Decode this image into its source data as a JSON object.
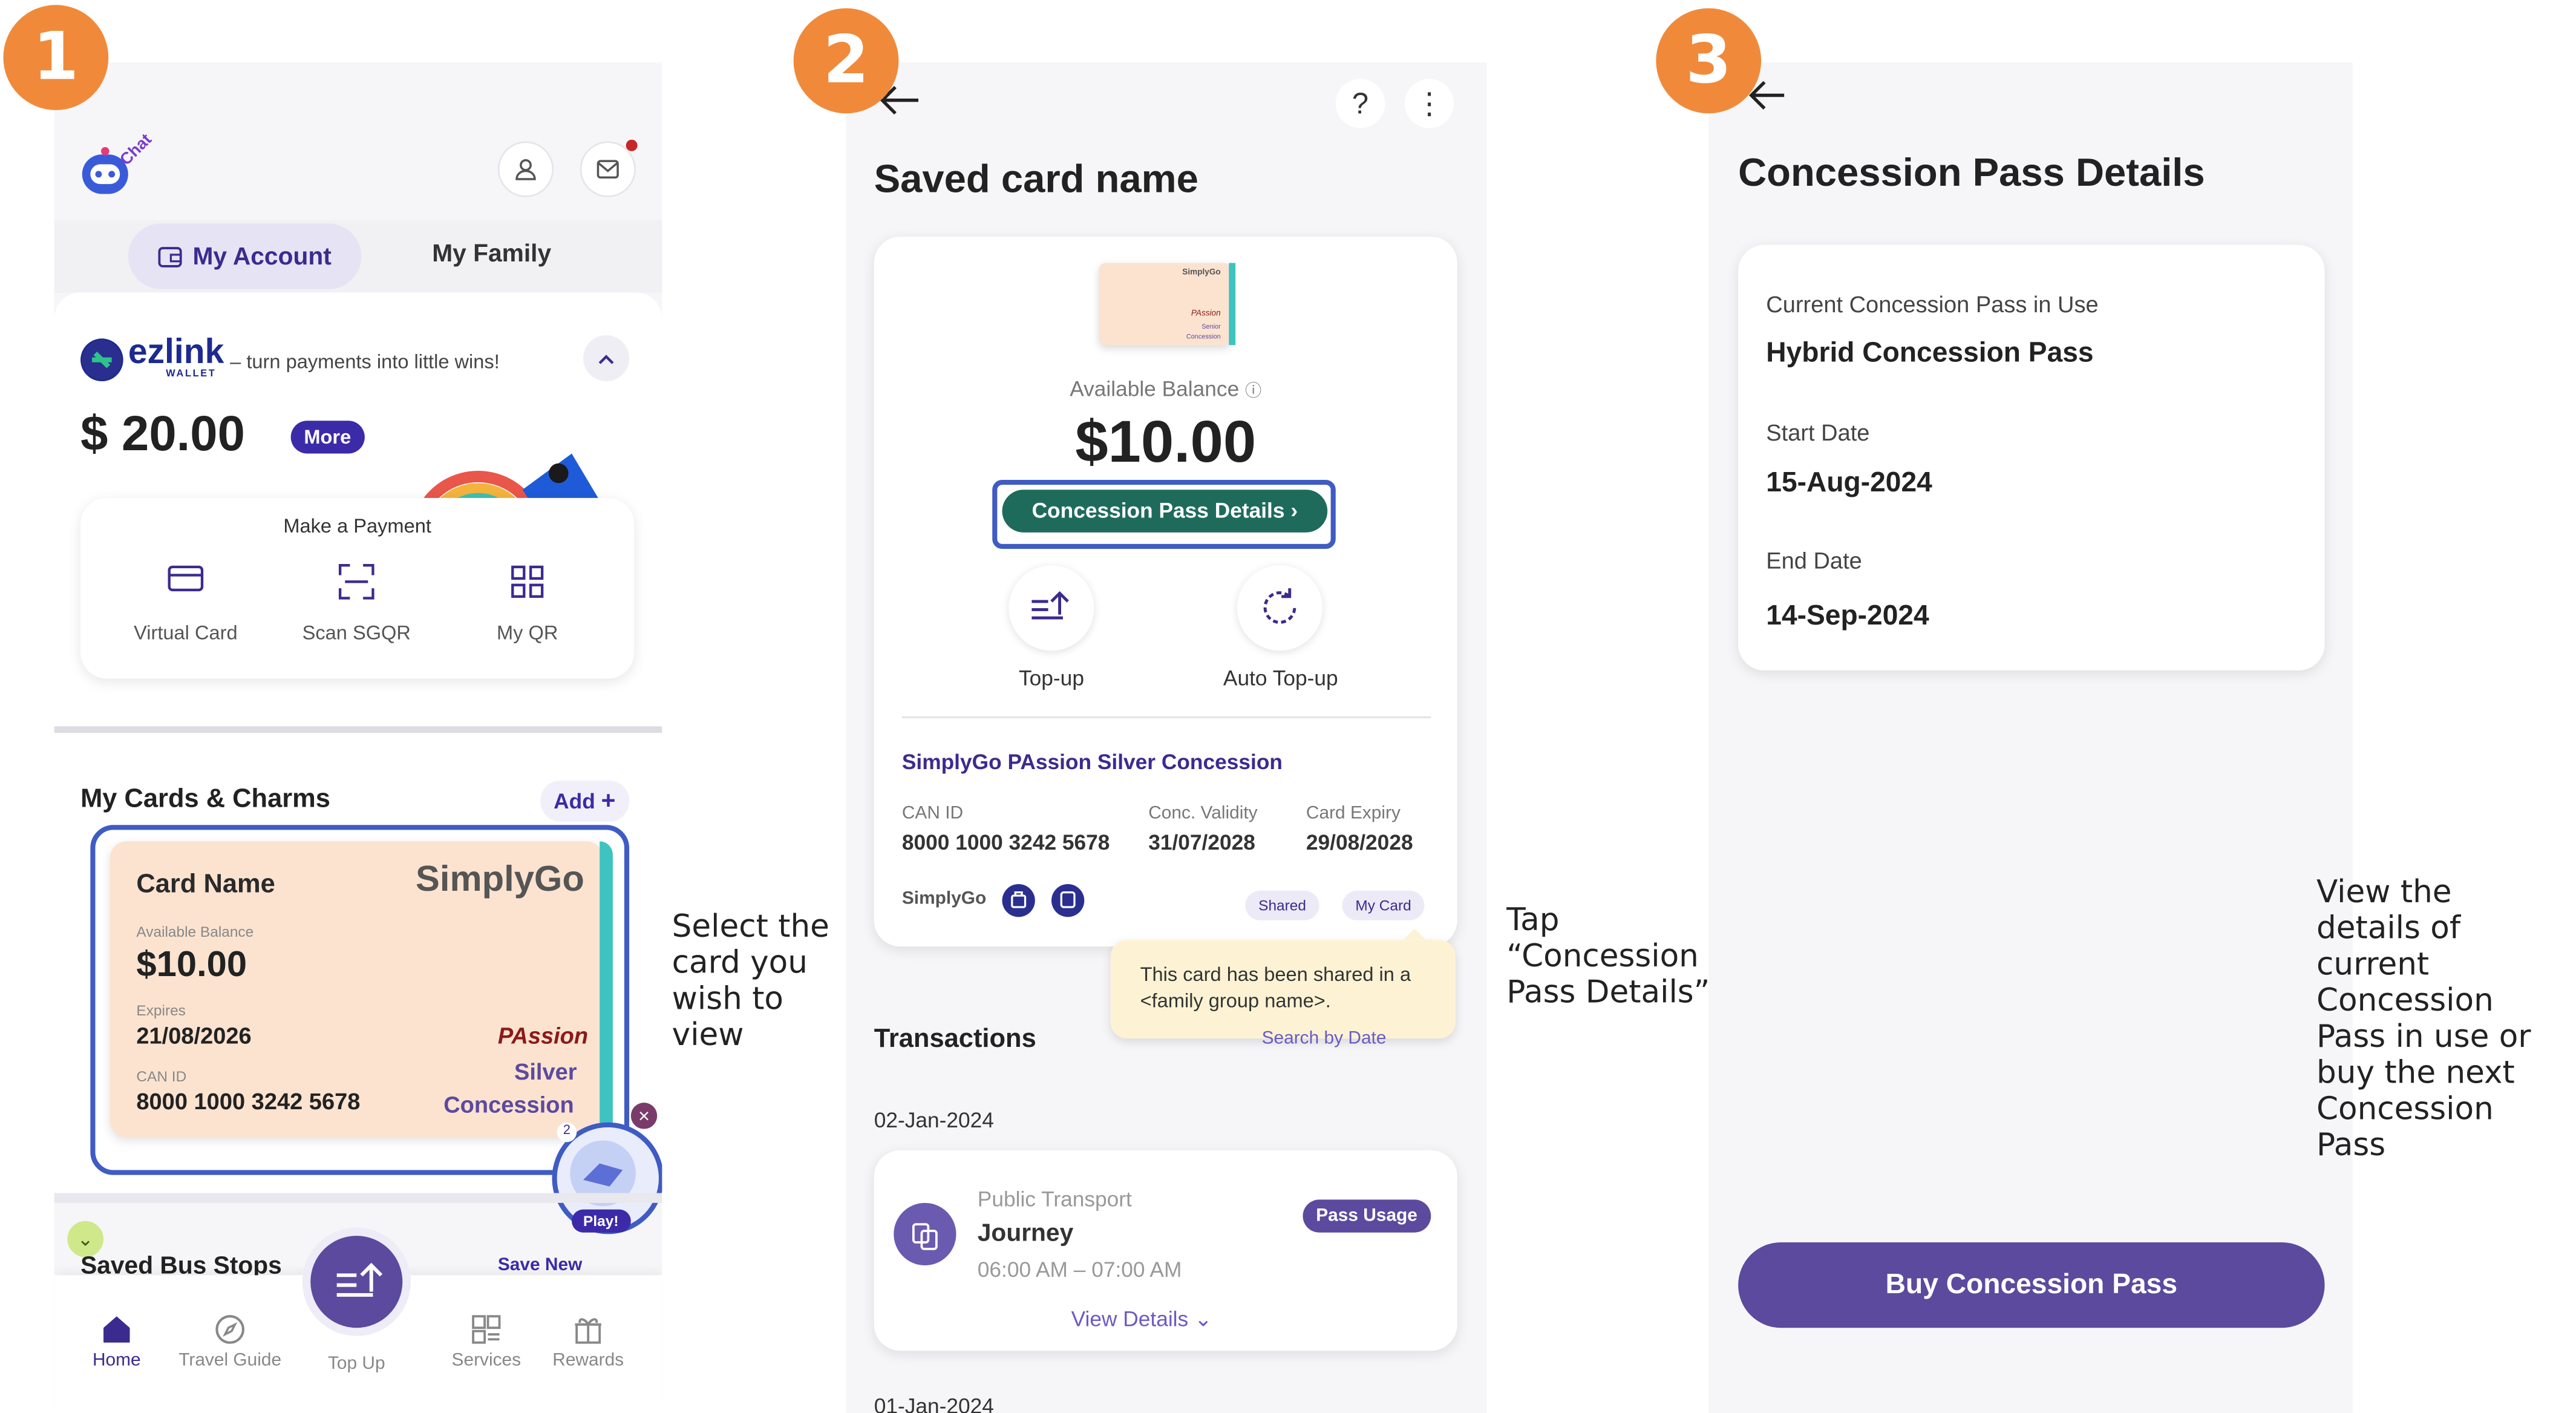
{
  "steps": [
    "1",
    "2",
    "3"
  ],
  "captions": {
    "c1": [
      "Select the",
      "card you",
      "wish to",
      "view"
    ],
    "c2": [
      "Tap",
      "“Concession",
      "Pass Details”"
    ],
    "c3": [
      "View the",
      "details of",
      "current",
      "Concession",
      "Pass in use or",
      "buy the next",
      "Concession",
      "Pass"
    ]
  },
  "screen1": {
    "chat_label": "Chat",
    "tabs": {
      "my_account": "My Account",
      "my_family": "My Family"
    },
    "wallet": {
      "brand": "ezlink",
      "brand_sub": "WALLET",
      "tagline": "– turn payments into little wins!",
      "balance": "$ 20.00",
      "more": "More"
    },
    "payment": {
      "title": "Make a Payment",
      "actions": [
        "Virtual Card",
        "Scan SGQR",
        "My QR"
      ]
    },
    "cards_section": {
      "title": "My Cards & Charms",
      "add": "Add"
    },
    "card": {
      "name": "Card Name",
      "brand": "SimplyGo",
      "balance_label": "Available Balance",
      "balance": "$10.00",
      "expires_label": "Expires",
      "expires": "21/08/2026",
      "can_label": "CAN ID",
      "can": "8000 1000 3242 5678",
      "passion": "PAssion",
      "tier": "Silver",
      "type": "Concession"
    },
    "play_label": "Play!",
    "play_count": "2",
    "bus_stops": {
      "title": "Saved Bus Stops",
      "save_new": "Save New"
    },
    "nav": [
      "Home",
      "Travel Guide",
      "Top Up",
      "Services",
      "Rewards"
    ]
  },
  "screen2": {
    "title": "Saved card name",
    "help": "?",
    "more": "⋮",
    "mini_card": {
      "brand": "SimplyGo",
      "passion": "PAssion",
      "line1": "Senior",
      "line2": "Concession"
    },
    "balance_label": "Available Balance",
    "balance": "$10.00",
    "concession_button": "Concession Pass Details",
    "actions": [
      "Top-up",
      "Auto Top-up"
    ],
    "card_type": "SimplyGo PAssion Silver Concession",
    "fields": [
      {
        "label": "CAN ID",
        "value": "8000 1000 3242 5678"
      },
      {
        "label": "Conc. Validity",
        "value": "31/07/2028"
      },
      {
        "label": "Card Expiry",
        "value": "29/08/2028"
      }
    ],
    "brand_small": "SimplyGo",
    "chips": [
      "Shared",
      "My Card"
    ],
    "tooltip": "This card has been shared in a <family group name>.",
    "transactions_title": "Transactions",
    "search": "Search by Date",
    "date1": "02-Jan-2024",
    "txn": {
      "category": "Public Transport",
      "title": "Journey",
      "time": "06:00 AM – 07:00 AM",
      "badge": "Pass Usage",
      "details": "View Details"
    },
    "date2": "01-Jan-2024"
  },
  "screen3": {
    "title": "Concession Pass Details",
    "current_label": "Current Concession Pass in Use",
    "current_value": "Hybrid Concession Pass",
    "start_label": "Start Date",
    "start_value": "15-Aug-2024",
    "end_label": "End Date",
    "end_value": "14-Sep-2024",
    "buy_button": "Buy Concession Pass"
  },
  "colors": {
    "step": "#f08a3a",
    "primary": "#5b4a9e",
    "teal": "#1e6b5c",
    "navy": "#3b2b8f",
    "card": "#fbe3d0"
  }
}
